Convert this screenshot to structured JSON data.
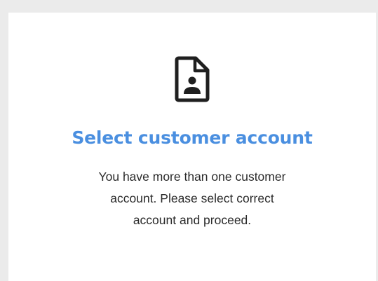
{
  "dialog": {
    "icon": "contact-document-icon",
    "title": "Select customer account",
    "message_lines": [
      "You have more than one customer",
      "account. Please select correct",
      "account and proceed."
    ],
    "title_color": "#4a8fe0",
    "text_color": "#2b2b2b"
  }
}
